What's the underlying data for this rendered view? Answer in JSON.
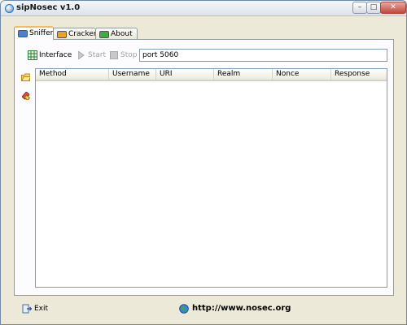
{
  "window": {
    "title": "sipNosec v1.0"
  },
  "caption_buttons": {
    "minimize": "–",
    "maximize": "□",
    "close": "✕"
  },
  "tabs": [
    {
      "label": "Sniffer",
      "active": true,
      "icon": "network-card-icon",
      "icon_color": "#4a7fd6"
    },
    {
      "label": "Cracker",
      "active": false,
      "icon": "key-icon",
      "icon_color": "#f0a020"
    },
    {
      "label": "About",
      "active": false,
      "icon": "info-icon",
      "icon_color": "#3cae3c"
    }
  ],
  "toolbar": {
    "interface_label": "Interface",
    "start_label": "Start",
    "stop_label": "Stop",
    "filter_value": "port 5060"
  },
  "side_icons": [
    "open-folder-icon",
    "clear-icon"
  ],
  "table": {
    "columns": [
      "Method",
      "Username",
      "URI",
      "Realm",
      "Nonce",
      "Response"
    ],
    "rows": []
  },
  "footer": {
    "exit_label": "Exit",
    "url": "http://www.nosec.org"
  }
}
